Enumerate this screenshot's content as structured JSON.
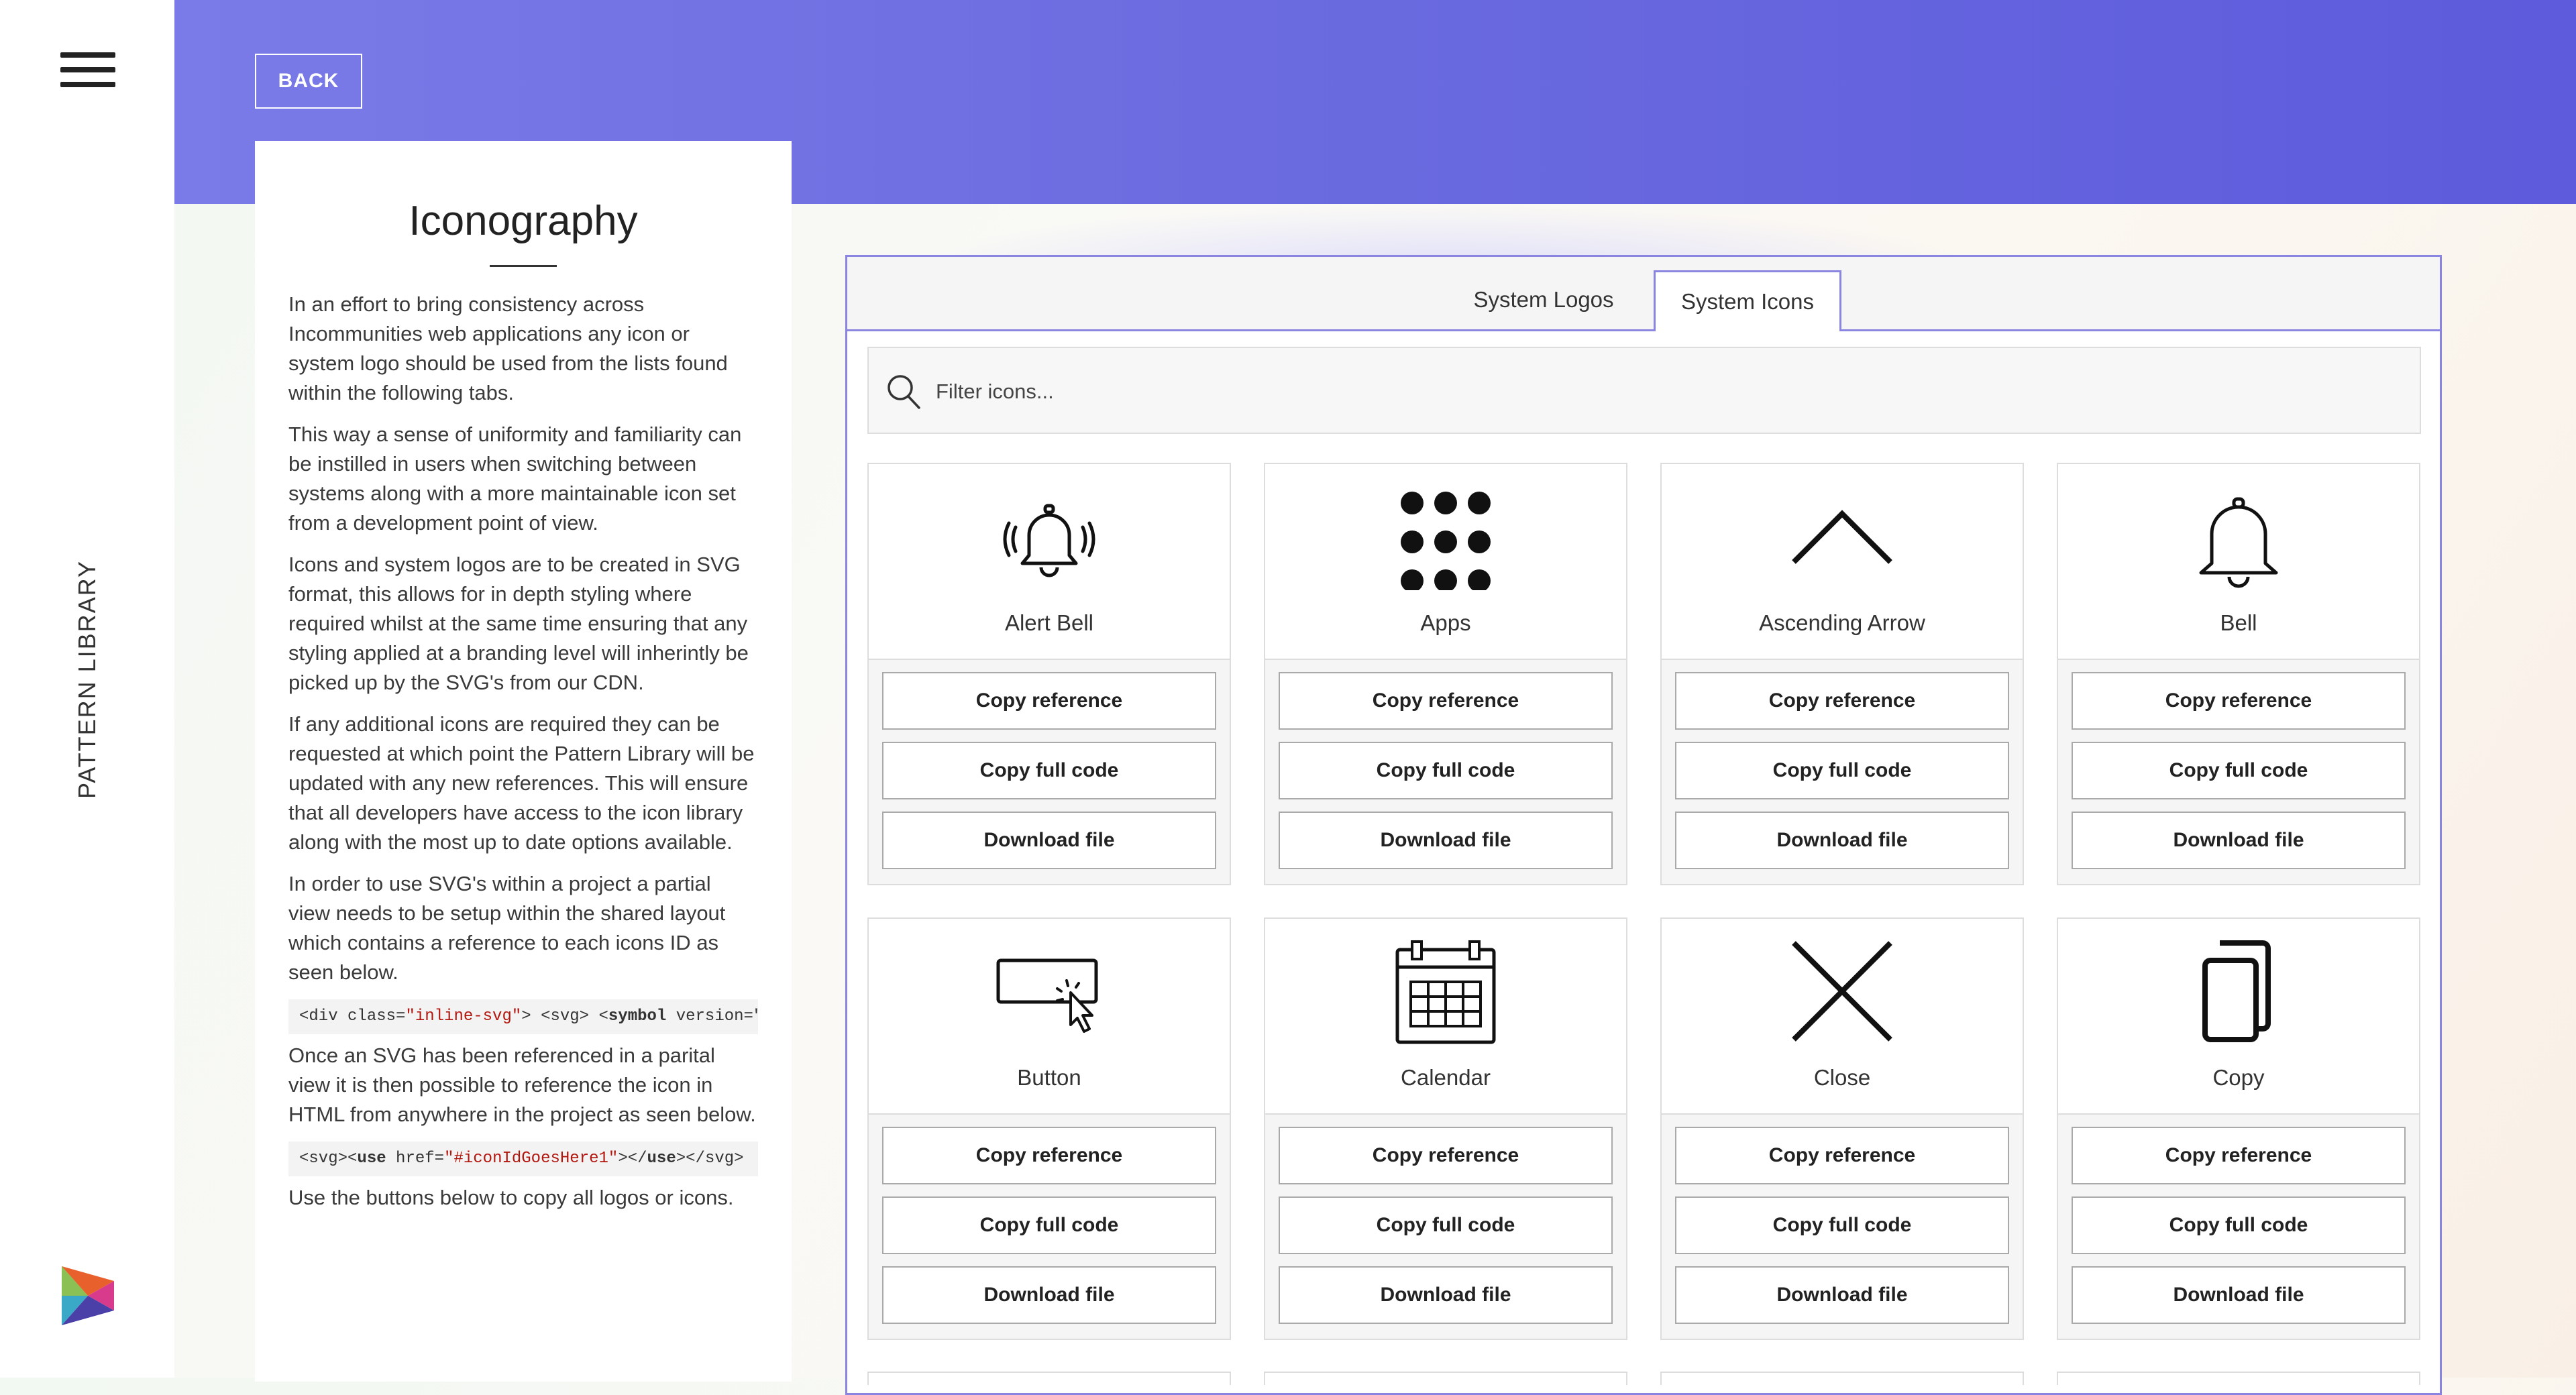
{
  "sidebar": {
    "label": "PATTERN LIBRARY"
  },
  "header": {
    "back_label": "BACK"
  },
  "intro": {
    "title": "Iconography",
    "paragraphs": [
      "In an effort to bring consistency across Incommunities web applications any icon or system logo should be used from the lists found within the following tabs.",
      "This way a sense of uniformity and familiarity can be instilled in users when switching between systems along with a more maintainable icon set from a development point of view.",
      "Icons and system logos are to be created in SVG format, this allows for in depth styling where required whilst at the same time ensuring that any styling applied at a branding level will inherintly be picked up by the SVG's from our CDN.",
      "If any additional icons are required they can be requested at which point the Pattern Library will be updated with any new references. This will ensure that all developers have access to the icon library along with the most up to date options available.",
      "In order to use SVG's within a project a partial view needs to be setup within the shared layout which contains a reference to each icons ID as seen below.",
      "Once an SVG has been referenced in a parital view it is then possible to reference the icon in HTML from anywhere in the project as seen below.",
      "Use the buttons below to copy all logos or icons."
    ],
    "code1": {
      "open": "<div class=",
      "cls": "\"inline-svg\"",
      "mid": "> <svg> <",
      "sym": "symbol",
      "tail": " version=\""
    },
    "code2": {
      "open": "<svg><",
      "use": "use",
      "attr": " href=",
      "val": "\"#iconIdGoesHere1\"",
      "close": "></",
      "use2": "use",
      "end": "></svg>"
    }
  },
  "tabs": {
    "logos": "System Logos",
    "icons": "System Icons",
    "active": "System Icons"
  },
  "search": {
    "placeholder": "Filter icons...",
    "value": ""
  },
  "button_labels": {
    "copy_reference": "Copy reference",
    "copy_full_code": "Copy full code",
    "download_file": "Download file"
  },
  "icons": [
    {
      "name": "Alert Bell",
      "icon": "alert-bell-icon"
    },
    {
      "name": "Apps",
      "icon": "apps-icon"
    },
    {
      "name": "Ascending Arrow",
      "icon": "ascending-arrow-icon"
    },
    {
      "name": "Bell",
      "icon": "bell-icon"
    },
    {
      "name": "Button",
      "icon": "button-icon"
    },
    {
      "name": "Calendar",
      "icon": "calendar-icon"
    },
    {
      "name": "Close",
      "icon": "close-icon"
    },
    {
      "name": "Copy",
      "icon": "copy-icon"
    }
  ]
}
